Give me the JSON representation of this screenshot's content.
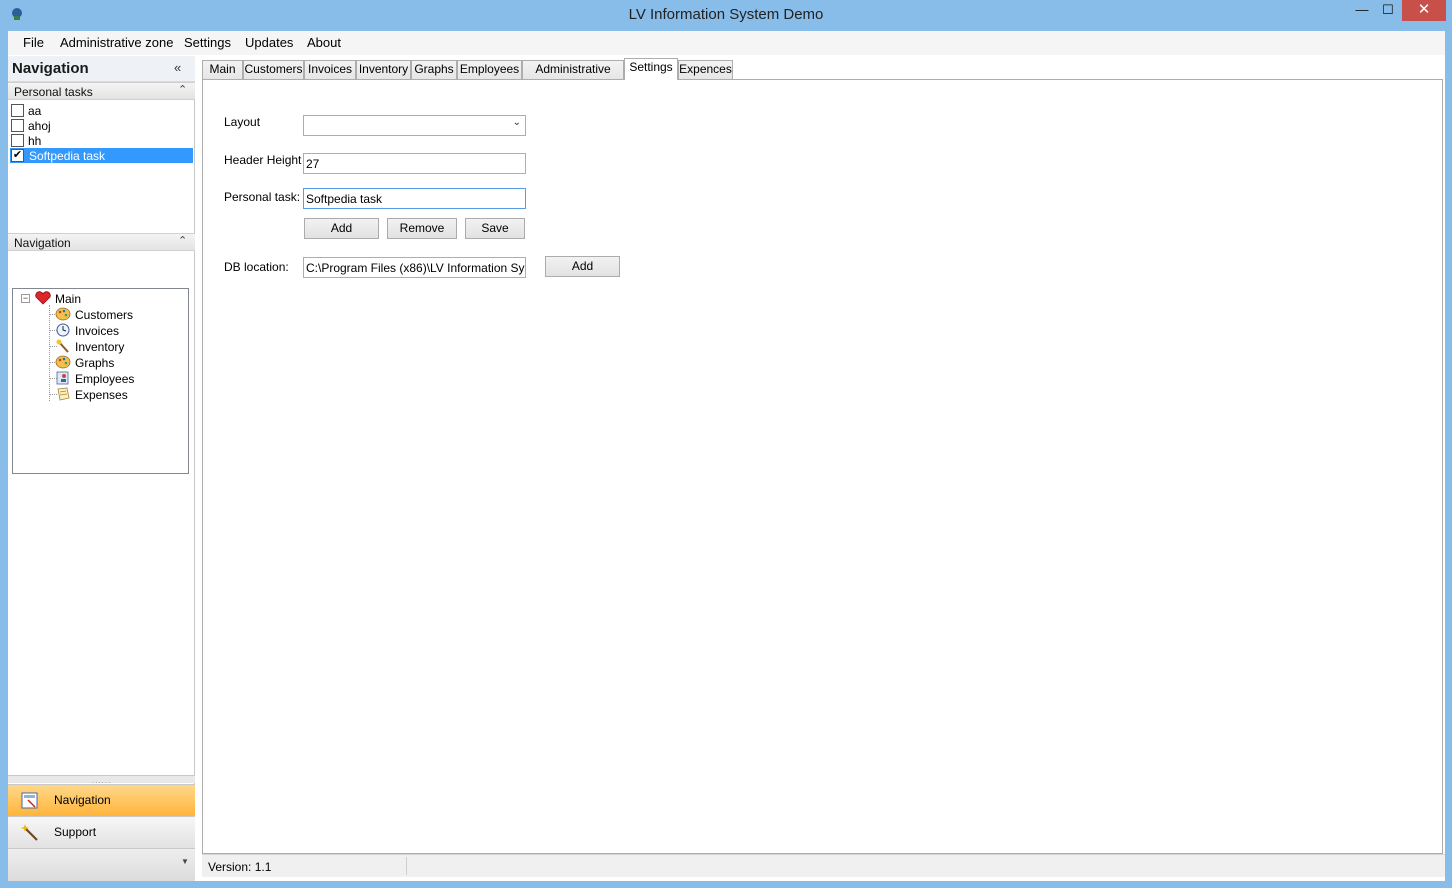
{
  "window": {
    "title": "LV Information System Demo",
    "minimize_glyph": "—",
    "maximize_glyph": "☐",
    "close_glyph": "✕"
  },
  "menu": [
    "File",
    "Administrative zone",
    "Settings",
    "Updates",
    "About"
  ],
  "navigation": {
    "title": "Navigation",
    "collapse_glyph": "«",
    "personal_tasks": {
      "header": "Personal tasks",
      "chevron": "⌃",
      "items": [
        {
          "label": "aa",
          "checked": false
        },
        {
          "label": "ahoj",
          "checked": false
        },
        {
          "label": "hh",
          "checked": false
        },
        {
          "label": "Softpedia task",
          "checked": true
        }
      ]
    },
    "tree_group": {
      "header": "Navigation",
      "chevron": "⌃",
      "root": "Main",
      "expander": "−",
      "children": [
        "Customers",
        "Invoices",
        "Inventory",
        "Graphs",
        "Employees",
        "Expenses"
      ]
    },
    "splitter_grip": "......",
    "buttons": [
      {
        "label": "Navigation",
        "icon": "navigation-icon",
        "selected": true
      },
      {
        "label": "Support",
        "icon": "wand-icon",
        "selected": false
      }
    ],
    "footer_arrow": "▼"
  },
  "tabs": [
    {
      "label": "Main",
      "active": false
    },
    {
      "label": "Customers",
      "active": false
    },
    {
      "label": "Invoices",
      "active": false
    },
    {
      "label": "Inventory",
      "active": false
    },
    {
      "label": "Graphs",
      "active": false
    },
    {
      "label": "Employees",
      "active": false
    },
    {
      "label": "Administrative zone",
      "active": false
    },
    {
      "label": "Settings",
      "active": true
    },
    {
      "label": "Expences",
      "active": false
    }
  ],
  "settings": {
    "layout_label": "Layout",
    "layout_value": "",
    "header_height_label": "Header Height",
    "header_height_value": "27",
    "personal_task_label": "Personal task:",
    "personal_task_value": "Softpedia task",
    "add_label": "Add",
    "remove_label": "Remove",
    "save_label": "Save",
    "db_location_label": "DB location:",
    "db_location_value": "C:\\Program Files (x86)\\LV Information System\\",
    "db_add_label": "Add",
    "dropdown_glyph": "⌄"
  },
  "status": {
    "version": "Version: 1.1"
  },
  "colors": {
    "title_bg": "#89bde9",
    "close_btn": "#c7504a",
    "selection": "#3399ff",
    "nav_selected": "#ffb43a"
  }
}
